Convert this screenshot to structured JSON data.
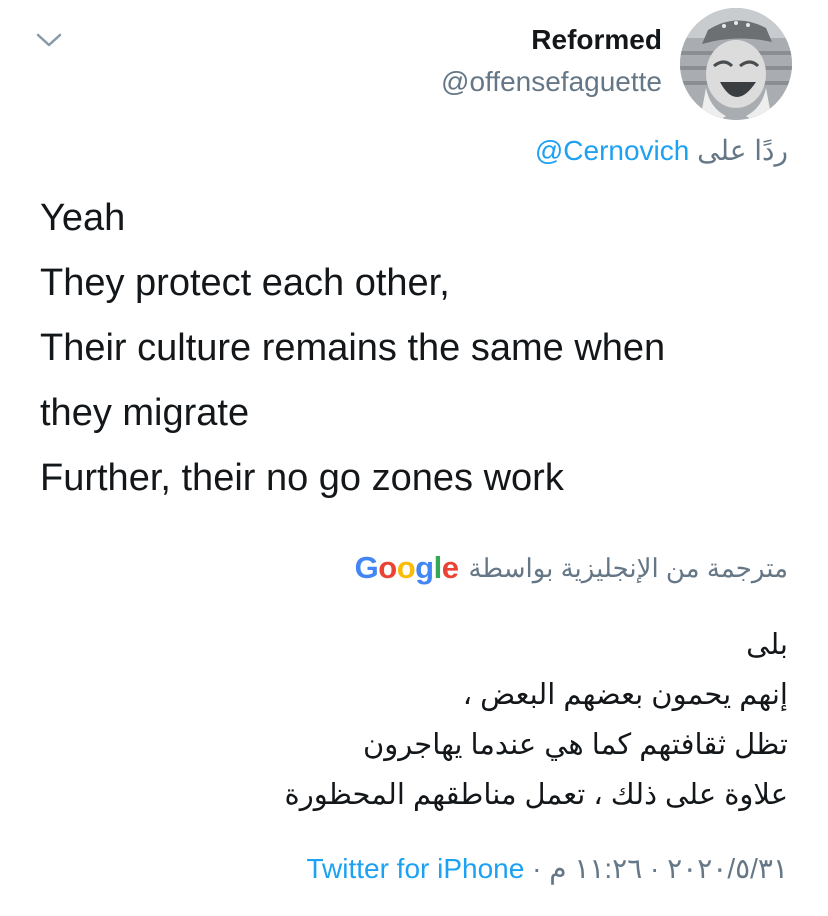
{
  "user": {
    "name": "Reformed",
    "handle": "@offensefaguette"
  },
  "reply": {
    "label": "ردًا على",
    "mention": "@Cernovich"
  },
  "tweet": {
    "lines": [
      "Yeah",
      "They protect each other,",
      "Their culture remains the same when",
      "they migrate",
      "Further, their no go zones work"
    ]
  },
  "translation": {
    "label": "مترجمة من الإنجليزية بواسطة",
    "provider": [
      "G",
      "o",
      "o",
      "g",
      "l",
      "e"
    ],
    "lines": [
      "بلى",
      "إنهم يحمون بعضهم البعض ،",
      "تظل ثقافتهم كما هي عندما يهاجرون",
      "علاوة على ذلك ، تعمل مناطقهم المحظورة"
    ]
  },
  "footer": {
    "datetime": "٢٠٢٠/٥/٣١ · ١١:٢٦ م",
    "separator": "·",
    "source": "Twitter for iPhone"
  },
  "colors": {
    "link": "#1da1f2",
    "secondary": "#657786",
    "text": "#14171a"
  },
  "icons": {
    "menu": "chevron-down-icon"
  }
}
